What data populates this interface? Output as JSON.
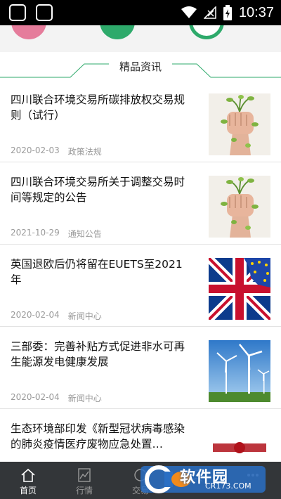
{
  "status_bar": {
    "time": "10:37"
  },
  "section": {
    "title": "精品资讯"
  },
  "articles": [
    {
      "title": "四川联合环境交易所碳排放权交易规则（试行）",
      "date": "2020-02-03",
      "category": "政策法规",
      "thumb": "fist-plant"
    },
    {
      "title": "四川联合环境交易所关于调整交易时间等规定的公告",
      "date": "2021-10-29",
      "category": "通知公告",
      "thumb": "fist-plant"
    },
    {
      "title": "英国退欧后仍将留在EUETS至2021年",
      "date": "2020-02-04",
      "category": "新闻中心",
      "thumb": "uk-eu-flags"
    },
    {
      "title": "三部委：完善补贴方式促进非水可再生能源发电健康发展",
      "date": "2020-02-04",
      "category": "新闻中心",
      "thumb": "wind-turbines"
    },
    {
      "title": "生态环境部印发《新型冠状病毒感染的肺炎疫情医疗废物应急处置…",
      "date": "",
      "category": "",
      "thumb": "red-seal-text"
    }
  ],
  "bottom_nav": [
    {
      "label": "首页",
      "icon": "home-icon",
      "active": true
    },
    {
      "label": "行情",
      "icon": "chart-icon",
      "active": false
    },
    {
      "label": "交易",
      "icon": "trade-icon",
      "active": false
    },
    {
      "label": "",
      "icon": "user-icon",
      "active": false
    },
    {
      "label": "",
      "icon": "more-icon",
      "active": false
    }
  ],
  "watermark": {
    "brand": "软件园",
    "url": "CR173.COM"
  },
  "colors": {
    "accent": "#2eaa6b",
    "nav_bg": "#333639",
    "meta": "#9a9a9a"
  }
}
